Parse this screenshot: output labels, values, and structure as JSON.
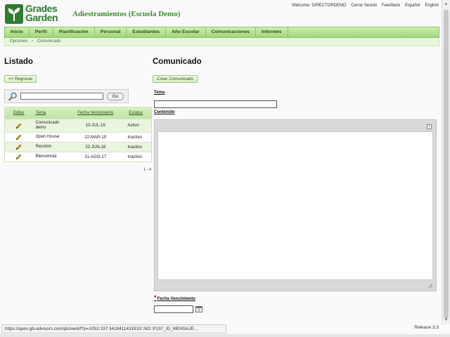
{
  "brand": {
    "logo_line1": "Grades",
    "logo_line2": "Garden",
    "app_title": "Adiestramientos (Escuela Demo)"
  },
  "top_links": {
    "welcome": "Welcome: DIRECTORDEMO",
    "logout": "Cerrar Sesión",
    "feedback": "Feedback",
    "spanish": "Español",
    "english": "English"
  },
  "nav": [
    "Inicio",
    "Perfil",
    "Planificación",
    "Personal",
    "Estudiantes",
    "Año Escolar",
    "Comunicaciones",
    "Informes"
  ],
  "breadcrumb": {
    "parent": "Opciones",
    "separator": "›",
    "current": "Comunicado"
  },
  "left": {
    "title": "Listado",
    "back_button": "<< Regresar",
    "search": {
      "value": "",
      "go_label": "Go"
    },
    "columns": {
      "edit": "Editar",
      "tema": "Tema",
      "fecha": "Fecha Vencimiento",
      "estatus": "Estatus"
    },
    "rows": [
      {
        "tema": "Comunicado demo",
        "fecha": "10-JUL-19",
        "estatus": "Activo"
      },
      {
        "tema": "Open House",
        "fecha": "22-MAR-19",
        "estatus": "Inactivo"
      },
      {
        "tema": "Reunión",
        "fecha": "22-JUN-18",
        "estatus": "Inactivo"
      },
      {
        "tema": "Bienvenida",
        "fecha": "31-AGO-17",
        "estatus": "Inactivo"
      }
    ],
    "pager": "1 - 4"
  },
  "right": {
    "title": "Comunicado",
    "create_button": "Crear Comunicado",
    "tema_label": "Tema",
    "tema_value": "",
    "contenido_label": "Contenido",
    "required_marker": "*",
    "fecha_label": "Fecha Vencimiento",
    "fecha_value": ""
  },
  "footer": {
    "release": "Release 3.3",
    "status_url": "https://apex.gb-advisors.com/pls/web/f?p=1052:197:3418411431919::NO::P197_ID_MENSAJE..."
  },
  "colors": {
    "brand_green": "#2e7d32",
    "nav_green": "#9fd77a",
    "title_green": "#3d8b2f"
  }
}
